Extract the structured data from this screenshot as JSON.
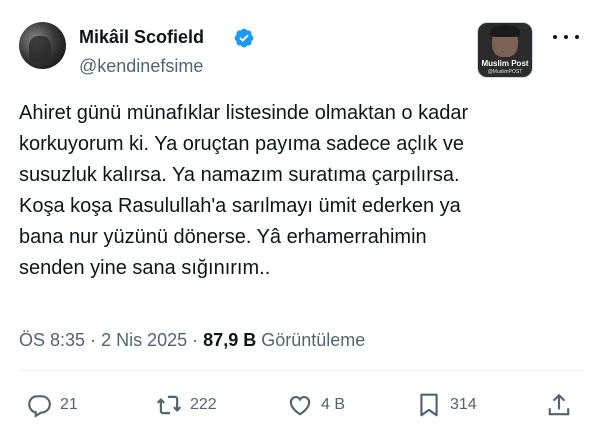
{
  "author": {
    "name": "Mikâil Scofield",
    "handle": "@kendinefsime",
    "verified": true
  },
  "badge": {
    "label": "Muslim Post",
    "sublabel": "@MuslimPOST"
  },
  "tweet": {
    "text": "Ahiret günü münafıklar listesinde olmaktan o kadar\nkorkuyorum ki. Ya oruçtan payıma sadece açlık ve\nsusuzluk kalırsa. Ya namazım suratıma çarpılırsa.\nKoşa koşa Rasulullah'a sarılmayı ümit ederken ya\nbana nur yüzünü dönerse. Yâ erhamerrahimin\nsenden yine sana sığınırım.."
  },
  "meta": {
    "time": "ÖS 8:35",
    "separator": "·",
    "date": "2 Nis 2025",
    "views_count": "87,9 B",
    "views_label": "Görüntüleme"
  },
  "actions": {
    "replies": "21",
    "reposts": "222",
    "likes": "4 B",
    "bookmarks": "314"
  },
  "colors": {
    "text": "#0f1419",
    "secondary": "#536471",
    "verified_blue": "#1d9bf0"
  },
  "icons": [
    "verified-badge-icon",
    "more-icon",
    "reply-icon",
    "repost-icon",
    "like-icon",
    "bookmark-icon",
    "share-icon"
  ]
}
